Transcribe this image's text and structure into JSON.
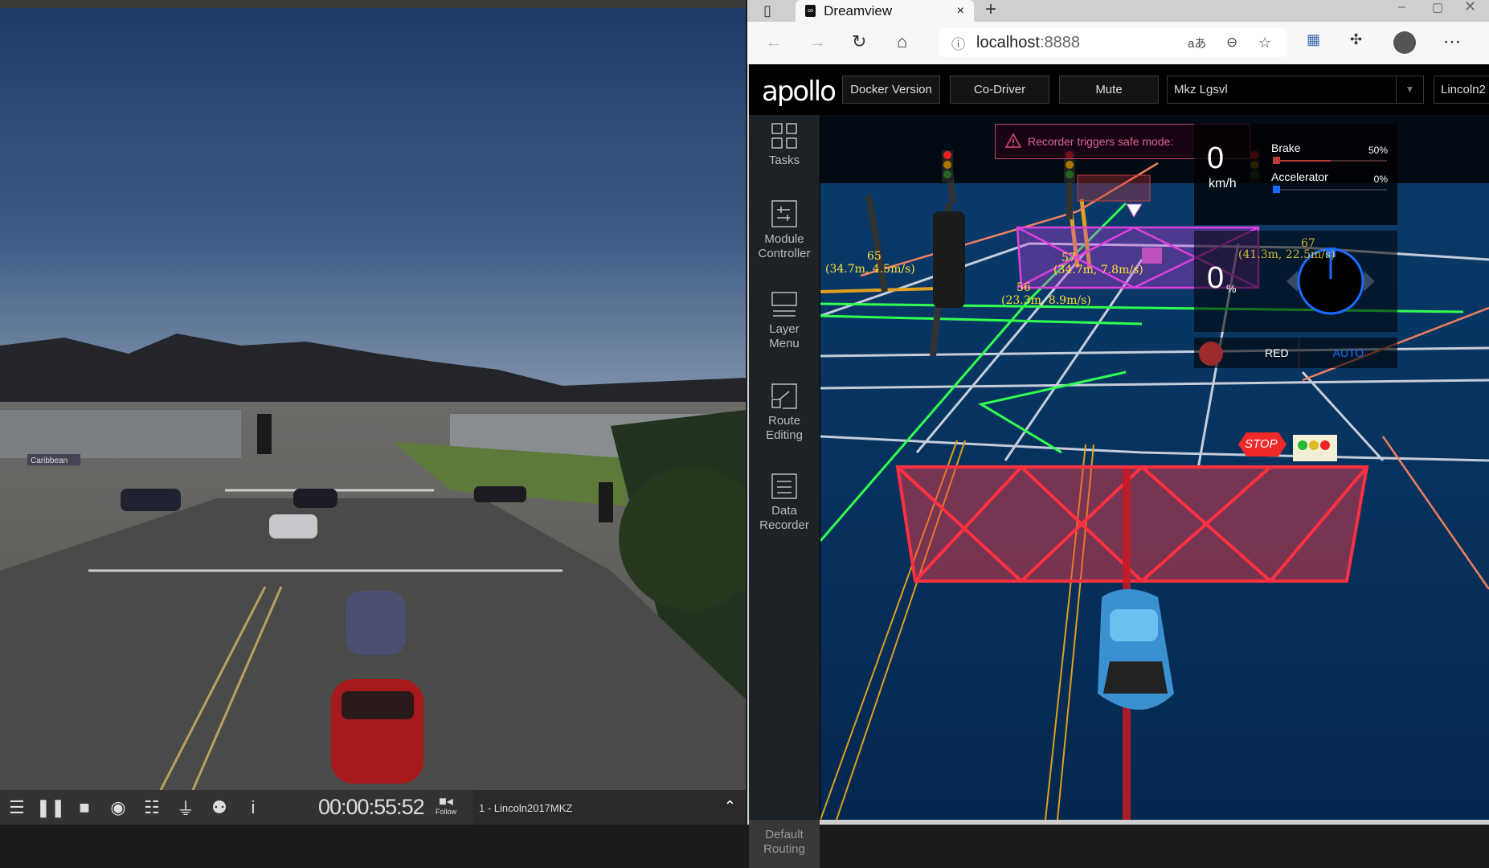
{
  "simulator": {
    "time": "00:00:55:52",
    "follow_label": "Follow",
    "vehicle": "1 - Lincoln2017MKZ",
    "street_sign": "Caribbean",
    "toolbar_icons": [
      "menu-icon",
      "pause-icon",
      "stop-icon",
      "eye-icon",
      "sliders-icon",
      "plug-icon",
      "gamepad-icon",
      "info-icon"
    ]
  },
  "browser": {
    "tab_title": "Dreamview",
    "url_host": "localhost",
    "url_port": ":8888"
  },
  "dreamview": {
    "logo": "apollo",
    "header": {
      "docker_version": "Docker Version",
      "co_driver": "Co-Driver",
      "mute": "Mute",
      "mode_select": "Mkz Lgsvl",
      "vehicle_select": "Lincoln2"
    },
    "sidebar": [
      {
        "line1": "Tasks",
        "line2": ""
      },
      {
        "line1": "Module",
        "line2": "Controller"
      },
      {
        "line1": "Layer",
        "line2": "Menu"
      },
      {
        "line1": "Route",
        "line2": "Editing"
      },
      {
        "line1": "Data",
        "line2": "Recorder"
      }
    ],
    "default_routing": {
      "line1": "Default",
      "line2": "Routing"
    },
    "alert": "Recorder triggers safe mode:",
    "dashboard": {
      "speed": "0",
      "speed_unit": "km/h",
      "brake_label": "Brake",
      "brake_value": "50%",
      "brake_fraction": 0.5,
      "accel_label": "Accelerator",
      "accel_value": "0%",
      "accel_fraction": 0,
      "steering": "0",
      "steering_unit": "%",
      "signal": "RED",
      "drive_mode": "AUTO"
    },
    "obstacles": [
      {
        "id": "65",
        "info": "(34.7m, 4.5m/s)"
      },
      {
        "id": "57",
        "info": "(34.7m, 7.8m/s)"
      },
      {
        "id": "56",
        "info": "(23.3m, 8.9m/s)"
      },
      {
        "id": "67",
        "info": "(41.3m, 22.5m/s)"
      }
    ],
    "stop_sign": "STOP"
  }
}
